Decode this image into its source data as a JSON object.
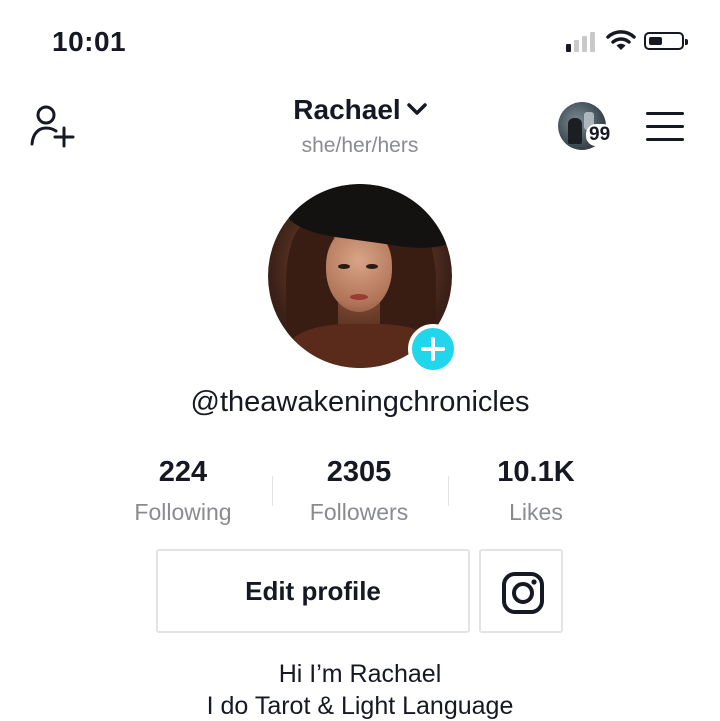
{
  "status_bar": {
    "time": "10:01",
    "signal_bars_active": 1,
    "icons": [
      "signal-icon",
      "wifi-icon",
      "battery-icon"
    ]
  },
  "header": {
    "name": "Rachael",
    "pronouns": "she/her/hers",
    "story_count": "99",
    "icons": [
      "add-user-icon",
      "chevron-down-icon",
      "menu-icon"
    ]
  },
  "profile": {
    "username": "@theawakeningchronicles",
    "add_badge_color": "#20d5ec"
  },
  "stats": {
    "following": {
      "value": "224",
      "label": "Following"
    },
    "followers": {
      "value": "2305",
      "label": "Followers"
    },
    "likes": {
      "value": "10.1K",
      "label": "Likes"
    }
  },
  "actions": {
    "edit_profile": "Edit profile",
    "instagram_icon": "instagram-icon"
  },
  "bio": {
    "line1": "Hi I’m Rachael",
    "line2": "I do Tarot & Light Language"
  }
}
